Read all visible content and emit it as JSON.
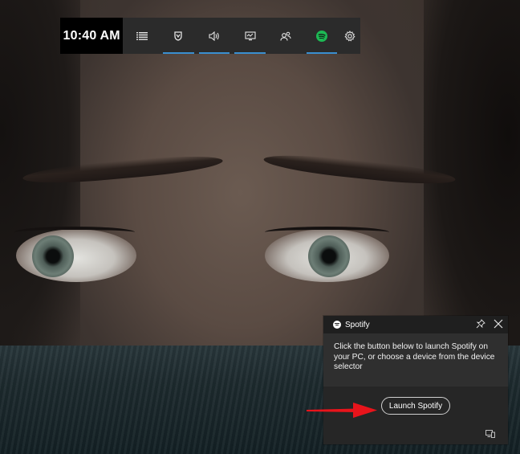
{
  "game_bar": {
    "time": "10:40 AM",
    "buttons": [
      {
        "icon": "menu-icon",
        "active": false
      },
      {
        "icon": "achievements-icon",
        "active": true
      },
      {
        "icon": "audio-icon",
        "active": true
      },
      {
        "icon": "performance-icon",
        "active": true
      },
      {
        "icon": "social-icon",
        "active": false
      },
      {
        "icon": "spotify-icon",
        "active": true
      },
      {
        "icon": "settings-icon",
        "active": false
      }
    ],
    "accent_color": "#3a8fd0",
    "spotify_color": "#1db954"
  },
  "spotify_widget": {
    "title": "Spotify",
    "message": "Click the button below to launch Spotify on your PC, or choose a device from the device selector",
    "launch_label": "Launch Spotify",
    "icons": [
      "spotify-logo-icon",
      "pin-icon",
      "close-icon",
      "device-selector-icon"
    ]
  },
  "annotation": {
    "arrow_color": "#e8141b"
  }
}
